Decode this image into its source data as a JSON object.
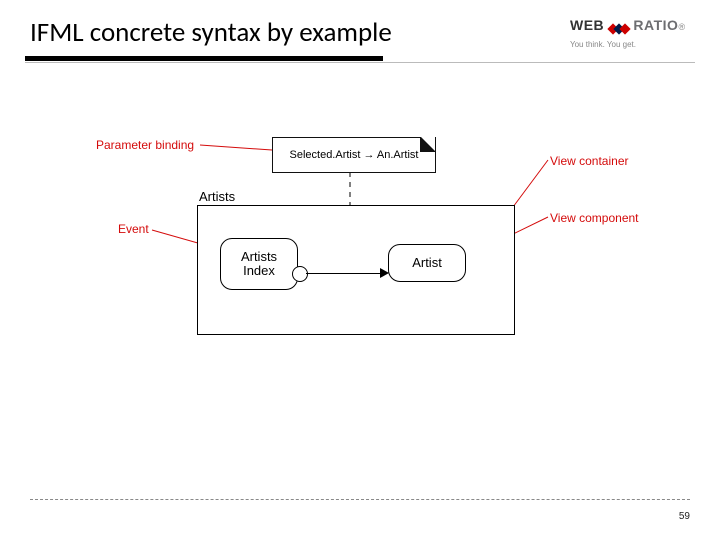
{
  "title": "IFML concrete syntax by example",
  "logo": {
    "left": "WEB",
    "right": "RATIO",
    "reg": "®",
    "tagline": "You think. You get."
  },
  "callouts": {
    "param_binding": "Parameter binding",
    "event": "Event",
    "view_container": "View container",
    "view_component": "View component"
  },
  "diagram": {
    "container_label": "Artists",
    "component1": "Artists\nIndex",
    "component2": "Artist",
    "note": "Selected.Artist → An.Artist"
  },
  "page_number": "59"
}
